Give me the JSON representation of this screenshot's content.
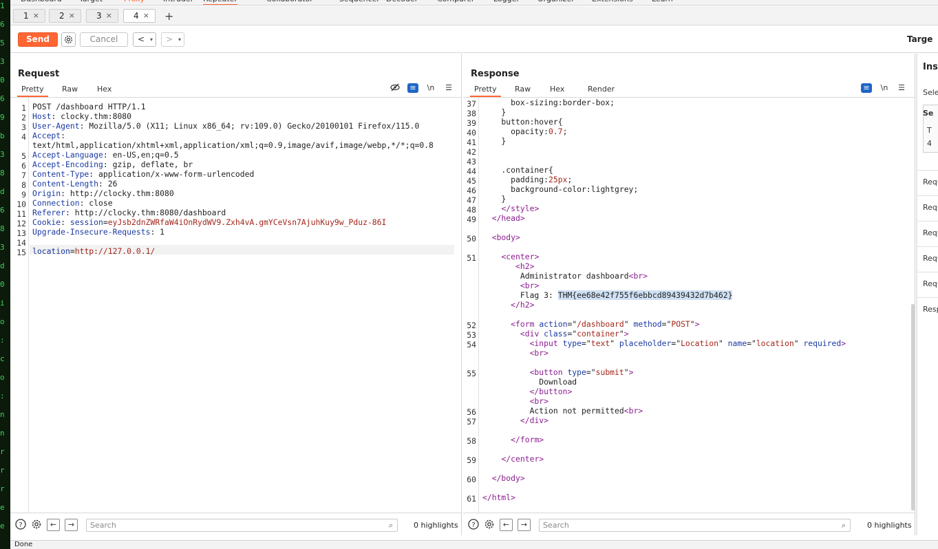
{
  "terminal_strip": {
    "lines": [
      "1",
      "6",
      "5",
      "3",
      "0",
      "6",
      "9",
      "b",
      "3",
      "8",
      "d",
      "6",
      "8",
      "3",
      "d",
      "0",
      "i",
      "o",
      ":",
      "c",
      "o",
      ":",
      "n",
      "n",
      "r",
      "r",
      "r",
      "e",
      "e"
    ]
  },
  "tool_tabs": [
    "Dashboard",
    "Target",
    "Proxy",
    "Intruder",
    "Repeater",
    "Collaborator",
    "Sequencer",
    "Decoder",
    "Comparer",
    "Logger",
    "Organizer",
    "Extensions",
    "Learn"
  ],
  "repeater_tabs": [
    {
      "label": "1",
      "close": "×"
    },
    {
      "label": "2",
      "close": "×"
    },
    {
      "label": "3",
      "close": "×"
    },
    {
      "label": "4",
      "close": "×"
    }
  ],
  "add_tab": "+",
  "toolbar": {
    "send_label": "Send",
    "cancel_label": "Cancel",
    "back_label": "<",
    "forward_label": ">",
    "dropdown": "▾",
    "target_label": "Targe"
  },
  "request": {
    "title": "Request",
    "tabs": [
      "Pretty",
      "Raw",
      "Hex"
    ],
    "newline_label": "\\n",
    "lines": [
      {
        "n": "1",
        "parts": [
          {
            "t": "POST /dashboard HTTP/1.1",
            "c": ""
          }
        ]
      },
      {
        "n": "2",
        "parts": [
          {
            "t": "Host",
            "c": "k"
          },
          {
            "t": ": clocky.thm:8080",
            "c": ""
          }
        ]
      },
      {
        "n": "3",
        "parts": [
          {
            "t": "User-Agent",
            "c": "k"
          },
          {
            "t": ": Mozilla/5.0 (X11; Linux x86_64; rv:109.0) Gecko/20100101 Firefox/115.0",
            "c": ""
          }
        ]
      },
      {
        "n": "4",
        "parts": [
          {
            "t": "Accept",
            "c": "k"
          },
          {
            "t": ":",
            "c": ""
          }
        ]
      },
      {
        "n": "",
        "parts": [
          {
            "t": "text/html,application/xhtml+xml,application/xml;q=0.9,image/avif,image/webp,*/*;q=0.8",
            "c": ""
          }
        ]
      },
      {
        "n": "5",
        "parts": [
          {
            "t": "Accept-Language",
            "c": "k"
          },
          {
            "t": ": en-US,en;q=0.5",
            "c": ""
          }
        ]
      },
      {
        "n": "6",
        "parts": [
          {
            "t": "Accept-Encoding",
            "c": "k"
          },
          {
            "t": ": gzip, deflate, br",
            "c": ""
          }
        ]
      },
      {
        "n": "7",
        "parts": [
          {
            "t": "Content-Type",
            "c": "k"
          },
          {
            "t": ": application/x-www-form-urlencoded",
            "c": ""
          }
        ]
      },
      {
        "n": "8",
        "parts": [
          {
            "t": "Content-Length",
            "c": "k"
          },
          {
            "t": ": 26",
            "c": ""
          }
        ]
      },
      {
        "n": "9",
        "parts": [
          {
            "t": "Origin",
            "c": "k"
          },
          {
            "t": ": http://clocky.thm:8080",
            "c": ""
          }
        ]
      },
      {
        "n": "10",
        "parts": [
          {
            "t": "Connection",
            "c": "k"
          },
          {
            "t": ": close",
            "c": ""
          }
        ]
      },
      {
        "n": "11",
        "parts": [
          {
            "t": "Referer",
            "c": "k"
          },
          {
            "t": ": http://clocky.thm:8080/dashboard",
            "c": ""
          }
        ]
      },
      {
        "n": "12",
        "parts": [
          {
            "t": "Cookie",
            "c": "k"
          },
          {
            "t": ": ",
            "c": ""
          },
          {
            "t": "session",
            "c": "k"
          },
          {
            "t": "=",
            "c": ""
          },
          {
            "t": "eyJsb2dnZWRfaW4iOnRydWV9.Zxh4vA.gmYCeVsn7AjuhKuy9w_Pduz-86I",
            "c": "v"
          }
        ]
      },
      {
        "n": "13",
        "parts": [
          {
            "t": "Upgrade-Insecure-Requests",
            "c": "k"
          },
          {
            "t": ": 1",
            "c": ""
          }
        ]
      },
      {
        "n": "14",
        "parts": []
      },
      {
        "n": "15",
        "parts": [
          {
            "t": "location",
            "c": "k"
          },
          {
            "t": "=",
            "c": ""
          },
          {
            "t": "http://127.0.0.1/",
            "c": "v"
          }
        ]
      }
    ],
    "search_placeholder": "Search",
    "highlights": "0 highlights"
  },
  "response": {
    "title": "Response",
    "tabs": [
      "Pretty",
      "Raw",
      "Hex",
      "Render"
    ],
    "newline_label": "\\n",
    "lines": [
      {
        "n": "37",
        "parts": [
          {
            "t": "      box-sizing:border-box;",
            "c": ""
          }
        ]
      },
      {
        "n": "38",
        "parts": [
          {
            "t": "    }",
            "c": ""
          }
        ]
      },
      {
        "n": "39",
        "parts": [
          {
            "t": "    button:hover{",
            "c": ""
          }
        ]
      },
      {
        "n": "40",
        "parts": [
          {
            "t": "      opacity:",
            "c": ""
          },
          {
            "t": "0.7",
            "c": "str"
          },
          {
            "t": ";",
            "c": ""
          }
        ]
      },
      {
        "n": "41",
        "parts": [
          {
            "t": "    }",
            "c": ""
          }
        ]
      },
      {
        "n": "42",
        "parts": []
      },
      {
        "n": "43",
        "parts": []
      },
      {
        "n": "44",
        "parts": [
          {
            "t": "    .container{",
            "c": ""
          }
        ]
      },
      {
        "n": "45",
        "parts": [
          {
            "t": "      padding:",
            "c": ""
          },
          {
            "t": "25px",
            "c": "str"
          },
          {
            "t": ";",
            "c": ""
          }
        ]
      },
      {
        "n": "46",
        "parts": [
          {
            "t": "      background-color:lightgrey;",
            "c": ""
          }
        ]
      },
      {
        "n": "47",
        "parts": [
          {
            "t": "    }",
            "c": ""
          }
        ]
      },
      {
        "n": "48",
        "parts": [
          {
            "t": "    ",
            "c": ""
          },
          {
            "t": "</style>",
            "c": "tag"
          }
        ]
      },
      {
        "n": "49",
        "parts": [
          {
            "t": "  ",
            "c": ""
          },
          {
            "t": "</head>",
            "c": "tag"
          }
        ]
      },
      {
        "n": "",
        "parts": []
      },
      {
        "n": "50",
        "parts": [
          {
            "t": "  ",
            "c": ""
          },
          {
            "t": "<body>",
            "c": "tag"
          }
        ]
      },
      {
        "n": "",
        "parts": []
      },
      {
        "n": "51",
        "parts": [
          {
            "t": "    ",
            "c": ""
          },
          {
            "t": "<center>",
            "c": "tag"
          }
        ]
      },
      {
        "n": "",
        "parts": [
          {
            "t": "       ",
            "c": ""
          },
          {
            "t": "<h2>",
            "c": "tag"
          }
        ]
      },
      {
        "n": "",
        "parts": [
          {
            "t": "        Administrator dashboard",
            "c": ""
          },
          {
            "t": "<br>",
            "c": "tag"
          }
        ]
      },
      {
        "n": "",
        "parts": [
          {
            "t": "        ",
            "c": ""
          },
          {
            "t": "<br>",
            "c": "tag"
          }
        ]
      },
      {
        "n": "",
        "parts": [
          {
            "t": "        Flag 3: ",
            "c": ""
          },
          {
            "t": "THM{ee68e42f755f6ebbcd89439432d7b462}",
            "c": "sel"
          }
        ]
      },
      {
        "n": "",
        "parts": [
          {
            "t": "      ",
            "c": ""
          },
          {
            "t": "</h2>",
            "c": "tag"
          }
        ]
      },
      {
        "n": "",
        "parts": []
      },
      {
        "n": "52",
        "parts": [
          {
            "t": "      ",
            "c": ""
          },
          {
            "t": "<form ",
            "c": "tag"
          },
          {
            "t": "action",
            "c": "attr"
          },
          {
            "t": "=\"",
            "c": ""
          },
          {
            "t": "/dashboard",
            "c": "str"
          },
          {
            "t": "\" ",
            "c": ""
          },
          {
            "t": "method",
            "c": "attr"
          },
          {
            "t": "=\"",
            "c": ""
          },
          {
            "t": "POST",
            "c": "str"
          },
          {
            "t": "\"",
            "c": ""
          },
          {
            "t": ">",
            "c": "tag"
          }
        ]
      },
      {
        "n": "53",
        "parts": [
          {
            "t": "        ",
            "c": ""
          },
          {
            "t": "<div ",
            "c": "tag"
          },
          {
            "t": "class",
            "c": "attr"
          },
          {
            "t": "=\"",
            "c": ""
          },
          {
            "t": "container",
            "c": "str"
          },
          {
            "t": "\"",
            "c": ""
          },
          {
            "t": ">",
            "c": "tag"
          }
        ]
      },
      {
        "n": "54",
        "parts": [
          {
            "t": "          ",
            "c": ""
          },
          {
            "t": "<input ",
            "c": "tag"
          },
          {
            "t": "type",
            "c": "attr"
          },
          {
            "t": "=\"",
            "c": ""
          },
          {
            "t": "text",
            "c": "str"
          },
          {
            "t": "\" ",
            "c": ""
          },
          {
            "t": "placeholder",
            "c": "attr"
          },
          {
            "t": "=\"",
            "c": ""
          },
          {
            "t": "Location",
            "c": "str"
          },
          {
            "t": "\" ",
            "c": ""
          },
          {
            "t": "name",
            "c": "attr"
          },
          {
            "t": "=\"",
            "c": ""
          },
          {
            "t": "location",
            "c": "str"
          },
          {
            "t": "\" ",
            "c": ""
          },
          {
            "t": "required",
            "c": "attr"
          },
          {
            "t": ">",
            "c": "tag"
          }
        ]
      },
      {
        "n": "",
        "parts": [
          {
            "t": "          ",
            "c": ""
          },
          {
            "t": "<br>",
            "c": "tag"
          }
        ]
      },
      {
        "n": "",
        "parts": []
      },
      {
        "n": "55",
        "parts": [
          {
            "t": "          ",
            "c": ""
          },
          {
            "t": "<button ",
            "c": "tag"
          },
          {
            "t": "type",
            "c": "attr"
          },
          {
            "t": "=\"",
            "c": ""
          },
          {
            "t": "submit",
            "c": "str"
          },
          {
            "t": "\"",
            "c": ""
          },
          {
            "t": ">",
            "c": "tag"
          }
        ]
      },
      {
        "n": "",
        "parts": [
          {
            "t": "            Download",
            "c": ""
          }
        ]
      },
      {
        "n": "",
        "parts": [
          {
            "t": "          ",
            "c": ""
          },
          {
            "t": "</button>",
            "c": "tag"
          }
        ]
      },
      {
        "n": "",
        "parts": [
          {
            "t": "          ",
            "c": ""
          },
          {
            "t": "<br>",
            "c": "tag"
          }
        ]
      },
      {
        "n": "56",
        "parts": [
          {
            "t": "          Action not permitted",
            "c": ""
          },
          {
            "t": "<br>",
            "c": "tag"
          }
        ]
      },
      {
        "n": "57",
        "parts": [
          {
            "t": "        ",
            "c": ""
          },
          {
            "t": "</div>",
            "c": "tag"
          }
        ]
      },
      {
        "n": "",
        "parts": []
      },
      {
        "n": "58",
        "parts": [
          {
            "t": "      ",
            "c": ""
          },
          {
            "t": "</form>",
            "c": "tag"
          }
        ]
      },
      {
        "n": "",
        "parts": []
      },
      {
        "n": "59",
        "parts": [
          {
            "t": "    ",
            "c": ""
          },
          {
            "t": "</center>",
            "c": "tag"
          }
        ]
      },
      {
        "n": "",
        "parts": []
      },
      {
        "n": "60",
        "parts": [
          {
            "t": "  ",
            "c": ""
          },
          {
            "t": "</body>",
            "c": "tag"
          }
        ]
      },
      {
        "n": "",
        "parts": []
      },
      {
        "n": "61",
        "parts": [
          {
            "t": "",
            "c": ""
          },
          {
            "t": "</html>",
            "c": "tag"
          }
        ]
      }
    ],
    "search_placeholder": "Search",
    "highlights": "0 highlights"
  },
  "inspector": {
    "title": "Insp",
    "rows": [
      "Selec",
      "Se",
      "T",
      "4",
      "Requ",
      "Requ",
      "Requ",
      "Requ",
      "Requ",
      "Resp"
    ]
  },
  "status": "Done",
  "colors": {
    "accent": "#ff6633",
    "blue": "#1f66c5"
  }
}
